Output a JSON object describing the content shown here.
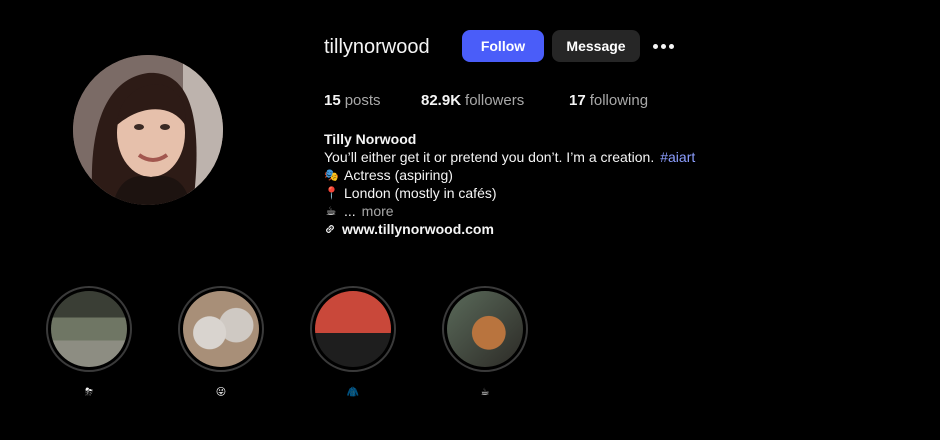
{
  "profile": {
    "username": "tillynorwood",
    "follow_label": "Follow",
    "message_label": "Message"
  },
  "stats": {
    "posts_count": "15",
    "posts_label": "posts",
    "followers_count": "82.9K",
    "followers_label": "followers",
    "following_count": "17",
    "following_label": "following"
  },
  "bio": {
    "name": "Tilly Norwood",
    "text": "You’ll either get it or pretend you don’t. I’m a creation.",
    "hashtag": "#aiart",
    "line1_emoji": "🎭",
    "line1_text": "Actress (aspiring)",
    "line2_emoji": "📍",
    "line2_text": "London (mostly in cafés)",
    "line3_emoji": "☕",
    "line3_text": "...",
    "more_label": "more",
    "link": "www.tillynorwood.com"
  },
  "highlights": [
    {
      "label": "⛈",
      "icon": "storm-cloud-icon"
    },
    {
      "label": "😜",
      "icon": "wink-face-icon"
    },
    {
      "label": "🧥",
      "icon": "coat-icon"
    },
    {
      "label": "☕",
      "icon": "coffee-icon"
    }
  ],
  "colors": {
    "background": "#000000",
    "follow_button": "#4a5df9",
    "message_button": "#262626",
    "hashtag": "#8c9eff",
    "muted_text": "#a8a8a8"
  }
}
